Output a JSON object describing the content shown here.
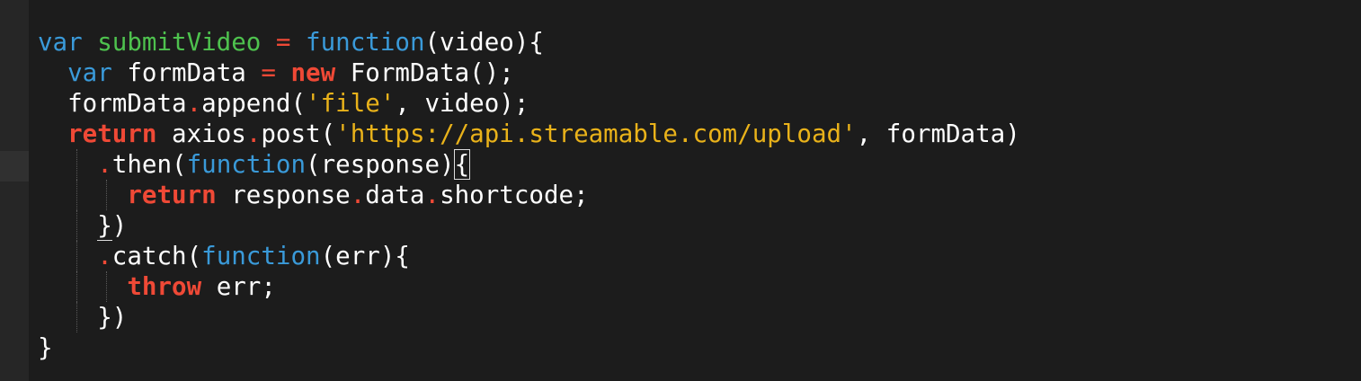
{
  "editor": {
    "theme": {
      "background": "#1c1c1c",
      "gutter": "#262626",
      "keyword_blue": "#3a9ad9",
      "keyword_green": "#4ec24e",
      "keyword_red": "#ef4936",
      "string": "#e9b21a",
      "text": "#ffffff"
    },
    "lines": [
      {
        "indent": 0,
        "tokens": [
          {
            "t": "var",
            "c": "kw-blue"
          },
          {
            "t": " ",
            "c": "plain"
          },
          {
            "t": "submitVideo",
            "c": "kw-green"
          },
          {
            "t": " ",
            "c": "plain"
          },
          {
            "t": "=",
            "c": "dot"
          },
          {
            "t": " ",
            "c": "plain"
          },
          {
            "t": "function",
            "c": "kw-blue"
          },
          {
            "t": "(video){",
            "c": "plain"
          }
        ]
      },
      {
        "indent": 1,
        "tokens": [
          {
            "t": "var",
            "c": "kw-blue"
          },
          {
            "t": " formData ",
            "c": "plain"
          },
          {
            "t": "=",
            "c": "dot"
          },
          {
            "t": " ",
            "c": "plain"
          },
          {
            "t": "new",
            "c": "kw-red"
          },
          {
            "t": " FormData();",
            "c": "plain"
          }
        ]
      },
      {
        "indent": 1,
        "tokens": [
          {
            "t": "formData",
            "c": "plain"
          },
          {
            "t": ".",
            "c": "dot"
          },
          {
            "t": "append(",
            "c": "plain"
          },
          {
            "t": "'file'",
            "c": "str"
          },
          {
            "t": ", video);",
            "c": "plain"
          }
        ]
      },
      {
        "indent": 1,
        "tokens": [
          {
            "t": "return",
            "c": "kw-red"
          },
          {
            "t": " axios",
            "c": "plain"
          },
          {
            "t": ".",
            "c": "dot"
          },
          {
            "t": "post(",
            "c": "plain"
          },
          {
            "t": "'https://api.streamable.com/upload'",
            "c": "str"
          },
          {
            "t": ", formData)",
            "c": "plain"
          }
        ]
      },
      {
        "indent": 2,
        "tokens": [
          {
            "t": ".",
            "c": "dot"
          },
          {
            "t": "then(",
            "c": "plain"
          },
          {
            "t": "function",
            "c": "kw-blue"
          },
          {
            "t": "(response)",
            "c": "plain"
          },
          {
            "t": "{",
            "c": "plain bracket-match"
          }
        ]
      },
      {
        "indent": 3,
        "tokens": [
          {
            "t": "return",
            "c": "kw-red"
          },
          {
            "t": " response",
            "c": "plain"
          },
          {
            "t": ".",
            "c": "dot"
          },
          {
            "t": "data",
            "c": "plain"
          },
          {
            "t": ".",
            "c": "dot"
          },
          {
            "t": "shortcode;",
            "c": "plain"
          }
        ]
      },
      {
        "indent": 2,
        "tokens": [
          {
            "t": "}",
            "c": "plain bracket-under"
          },
          {
            "t": ")",
            "c": "plain"
          }
        ]
      },
      {
        "indent": 2,
        "tokens": [
          {
            "t": ".",
            "c": "dot"
          },
          {
            "t": "catch(",
            "c": "plain"
          },
          {
            "t": "function",
            "c": "kw-blue"
          },
          {
            "t": "(err){",
            "c": "plain"
          }
        ]
      },
      {
        "indent": 3,
        "tokens": [
          {
            "t": "throw",
            "c": "kw-red"
          },
          {
            "t": " err;",
            "c": "plain"
          }
        ]
      },
      {
        "indent": 2,
        "tokens": [
          {
            "t": "})",
            "c": "plain"
          }
        ]
      },
      {
        "indent": 0,
        "tokens": [
          {
            "t": "}",
            "c": "plain"
          }
        ]
      }
    ]
  }
}
